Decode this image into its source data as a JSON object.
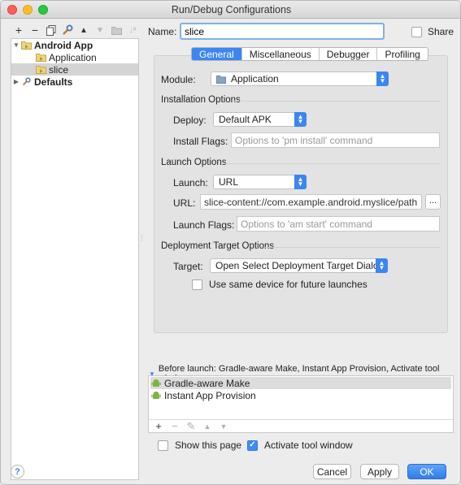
{
  "window": {
    "title": "Run/Debug Configurations"
  },
  "sidebar": {
    "toolbar": [
      "add-icon",
      "remove-icon",
      "copy-icon",
      "wrench-icon",
      "move-up-icon",
      "move-down-icon",
      "folder-icon",
      "sort-icon"
    ],
    "tree": [
      {
        "label": "Android App",
        "expanded": true,
        "bold": true
      },
      {
        "label": "Application"
      },
      {
        "label": "slice",
        "selected": true
      },
      {
        "label": "Defaults",
        "expanded": false,
        "bold": true
      }
    ]
  },
  "header": {
    "name_label": "Name:",
    "name_value": "slice",
    "share_label": "Share",
    "share_checked": false
  },
  "tabs": [
    {
      "label": "General",
      "active": true
    },
    {
      "label": "Miscellaneous"
    },
    {
      "label": "Debugger"
    },
    {
      "label": "Profiling"
    }
  ],
  "general": {
    "module_label": "Module:",
    "module_value": "Application",
    "install_section": "Installation Options",
    "deploy_label": "Deploy:",
    "deploy_value": "Default APK",
    "install_flags_label": "Install Flags:",
    "install_flags_placeholder": "Options to 'pm install' command",
    "launch_section": "Launch Options",
    "launch_label": "Launch:",
    "launch_value": "URL",
    "url_label": "URL:",
    "url_value": "slice-content://com.example.android.myslice/path",
    "url_browse": "...",
    "launch_flags_label": "Launch Flags:",
    "launch_flags_placeholder": "Options to 'am start' command",
    "target_section": "Deployment Target Options",
    "target_label": "Target:",
    "target_value": "Open Select Deployment Target Dialog",
    "same_device_label": "Use same device for future launches",
    "same_device_checked": false
  },
  "before_launch": {
    "title": "Before launch: Gradle-aware Make, Instant App Provision, Activate tool window",
    "items": [
      {
        "label": "Gradle-aware Make",
        "selected": true
      },
      {
        "label": "Instant App Provision"
      }
    ],
    "tools": [
      "add-icon",
      "remove-icon",
      "edit-icon",
      "move-up-icon",
      "move-down-icon"
    ]
  },
  "footer": {
    "show_page_label": "Show this page",
    "show_page_checked": false,
    "activate_label": "Activate tool window",
    "activate_checked": true,
    "help": "?",
    "cancel": "Cancel",
    "apply": "Apply",
    "ok": "OK"
  },
  "colors": {
    "accent": "#3b86f0",
    "android": "#7cb342"
  }
}
